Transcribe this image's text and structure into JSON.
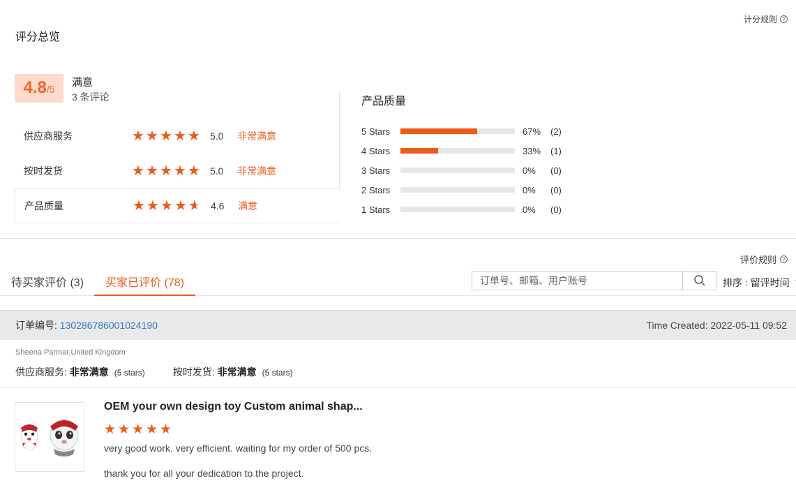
{
  "overview": {
    "title": "评分总览",
    "rules_label": "计分规则",
    "score": "4.8",
    "score_max": "/5",
    "verdict": "满意",
    "review_count": "3 条评论"
  },
  "categories": [
    {
      "name": "供应商服务",
      "rating": 5.0,
      "score": "5.0",
      "verdict": "非常满意"
    },
    {
      "name": "按时发货",
      "rating": 5.0,
      "score": "5.0",
      "verdict": "非常满意"
    },
    {
      "name": "产品质量",
      "rating": 4.6,
      "score": "4.6",
      "verdict": "满意"
    }
  ],
  "quality": {
    "title": "产品质量",
    "rows": [
      {
        "label": "5  Stars",
        "fraction": 0.67,
        "pct": "67%",
        "count": "(2)"
      },
      {
        "label": "4  Stars",
        "fraction": 0.33,
        "pct": "33%",
        "count": "(1)"
      },
      {
        "label": "3  Stars",
        "fraction": 0,
        "pct": "0%",
        "count": "(0)"
      },
      {
        "label": "2  Stars",
        "fraction": 0,
        "pct": "0%",
        "count": "(0)"
      },
      {
        "label": "1  Stars",
        "fraction": 0,
        "pct": "0%",
        "count": "(0)"
      }
    ]
  },
  "tabs": {
    "rules_label": "评价规则",
    "pending": "待买家评价 (3)",
    "done": "买家已评价 (78)"
  },
  "search": {
    "placeholder": "订单号、邮箱、用户账号",
    "value": ""
  },
  "sort": {
    "label": "排序 : ",
    "value": "留评时间"
  },
  "order": {
    "label": "订单编号: ",
    "number": "130286786001024190",
    "time": "Time Created: 2022-05-11 09:52",
    "reviewer": "Sheena Parmar,United Kingdom",
    "supplier_label": "供应商服务: ",
    "supplier_value": "非常满意",
    "supplier_stars": "(5 stars)",
    "shipping_label": "按时发货: ",
    "shipping_value": "非常满意",
    "shipping_stars": "(5 stars)"
  },
  "review": {
    "product_title": "OEM your own design toy Custom animal shap...",
    "rating": 5,
    "text1": "very good work. very efficient. waiting for my order of 500 pcs.",
    "text2": "thank you for all your dedication to the project."
  },
  "colors": {
    "accent": "#ec5b1b",
    "score_bg": "#fddacb",
    "link": "#2e76c4"
  }
}
